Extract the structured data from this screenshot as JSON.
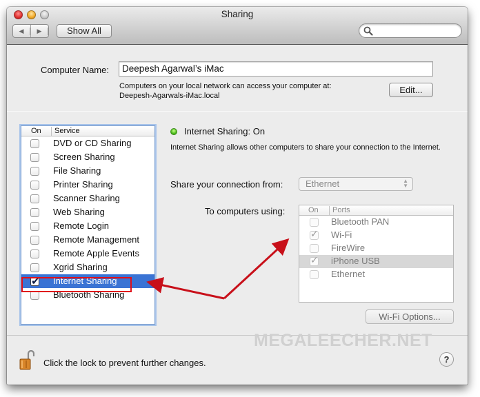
{
  "window": {
    "title": "Sharing",
    "nav": {
      "back_icon": "triangle-left-icon",
      "forward_icon": "triangle-right-icon"
    },
    "show_all_label": "Show All",
    "search": {
      "placeholder": "",
      "value": ""
    }
  },
  "computer_name": {
    "label": "Computer Name:",
    "value": "Deepesh Agarwal’s iMac",
    "help_line1": "Computers on your local network can access your computer at:",
    "help_line2": "Deepesh-Agarwals-iMac.local",
    "edit_label": "Edit..."
  },
  "services": {
    "col_on": "On",
    "col_service": "Service",
    "items": [
      {
        "label": "DVD or CD Sharing",
        "checked": false
      },
      {
        "label": "Screen Sharing",
        "checked": false
      },
      {
        "label": "File Sharing",
        "checked": false
      },
      {
        "label": "Printer Sharing",
        "checked": false
      },
      {
        "label": "Scanner Sharing",
        "checked": false
      },
      {
        "label": "Web Sharing",
        "checked": false
      },
      {
        "label": "Remote Login",
        "checked": false
      },
      {
        "label": "Remote Management",
        "checked": false
      },
      {
        "label": "Remote Apple Events",
        "checked": false
      },
      {
        "label": "Xgrid Sharing",
        "checked": false
      },
      {
        "label": "Internet Sharing",
        "checked": true,
        "selected": true
      },
      {
        "label": "Bluetooth Sharing",
        "checked": false
      }
    ]
  },
  "detail": {
    "status": "Internet Sharing: On",
    "status_color": "#4cbc1c",
    "description": "Internet Sharing allows other computers to share your connection to the Internet.",
    "share_from_label": "Share your connection from:",
    "share_from_value": "Ethernet",
    "to_computers_label": "To computers using:",
    "ports_col_on": "On",
    "ports_col_ports": "Ports",
    "ports": [
      {
        "label": "Bluetooth PAN",
        "checked": false
      },
      {
        "label": "Wi-Fi",
        "checked": true
      },
      {
        "label": "FireWire",
        "checked": false
      },
      {
        "label": "iPhone USB",
        "checked": true,
        "selected": true
      },
      {
        "label": "Ethernet",
        "checked": false
      }
    ],
    "wifi_options_label": "Wi-Fi Options..."
  },
  "footer": {
    "lock_text": "Click the lock to prevent further changes.",
    "help_label": "?"
  },
  "watermark": "MEGALEECHER.NET",
  "annotation_color": "#c8101a"
}
